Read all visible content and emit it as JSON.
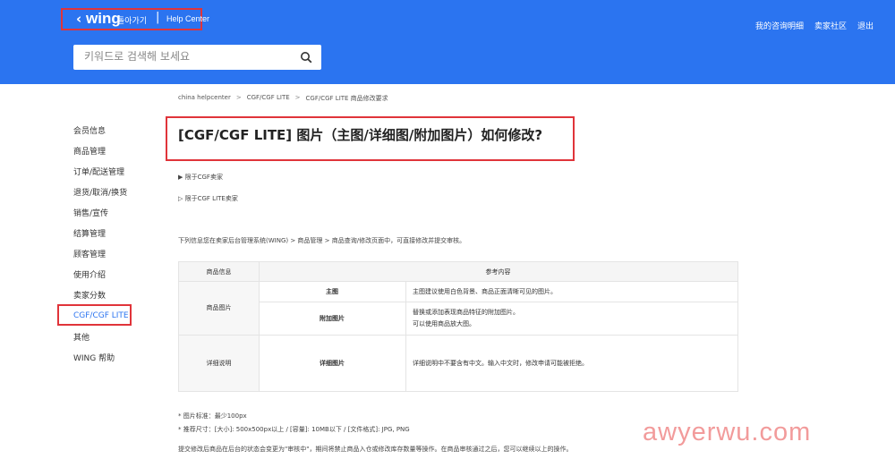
{
  "header": {
    "brand": "wing",
    "back_label": "돌아가기",
    "separator": "|",
    "help_center": "Help Center",
    "search_placeholder": "키워드로 검색해 보세요",
    "top_links": [
      "我的咨询明细",
      "卖家社区",
      "退出"
    ]
  },
  "sidebar": {
    "items": [
      "会员信息",
      "商品管理",
      "订单/配送管理",
      "退货/取消/换货",
      "销售/宣传",
      "结算管理",
      "顾客管理",
      "使用介绍",
      "卖家分数",
      "CGF/CGF LITE",
      "其他",
      "WING 帮助"
    ],
    "active_index": 9
  },
  "breadcrumb": [
    "china helpcenter",
    ">",
    "CGF/CGF LITE",
    ">",
    "CGF/CGF LITE 商品修改要求"
  ],
  "page_title": "[CGF/CGF LITE] 图片（主图/详细图/附加图片）如何修改?",
  "notes": [
    "▶ 限于CGF卖家",
    "▷ 限于CGF LITE卖家"
  ],
  "intro": "下列信息您在卖家后台管理系统(WING) > 商品管理 > 商品查询/修改页面中，可直接修改并提交审核。",
  "table": {
    "headers": [
      "商品信息",
      "参考内容"
    ],
    "group1": "商品图片",
    "row1_label": "主图",
    "row1_text": "主图建议使用白色背景、商品正面清晰可见的图片。",
    "row2_label": "附加图片",
    "row2_text_1": "替换或添加表现商品特征的附加图片。",
    "row2_text_2": "可以使用商品放大图。",
    "group2": "详细说明",
    "row3_label": "详细图片",
    "row3_text": "详细说明中不要含有中文。输入中文时，修改申请可能被拒绝。"
  },
  "footnotes": [
    "* 图片标准：最少100px",
    "* 推荐尺寸：[大小]: 500x500px以上 / [容量]: 10MB以下 / [文件格式]: JPG, PNG",
    "提交修改后商品在后台的状态会变更为\"审核中\"，期间将禁止商品入仓或修改库存数量等操作。在商品审核通过之后，您可以继续以上的操作。"
  ],
  "watermark": "awyerwu.com",
  "colors": {
    "header_bg": "#2b74f0",
    "highlight": "#e0343a",
    "active_link": "#2b74f0"
  }
}
